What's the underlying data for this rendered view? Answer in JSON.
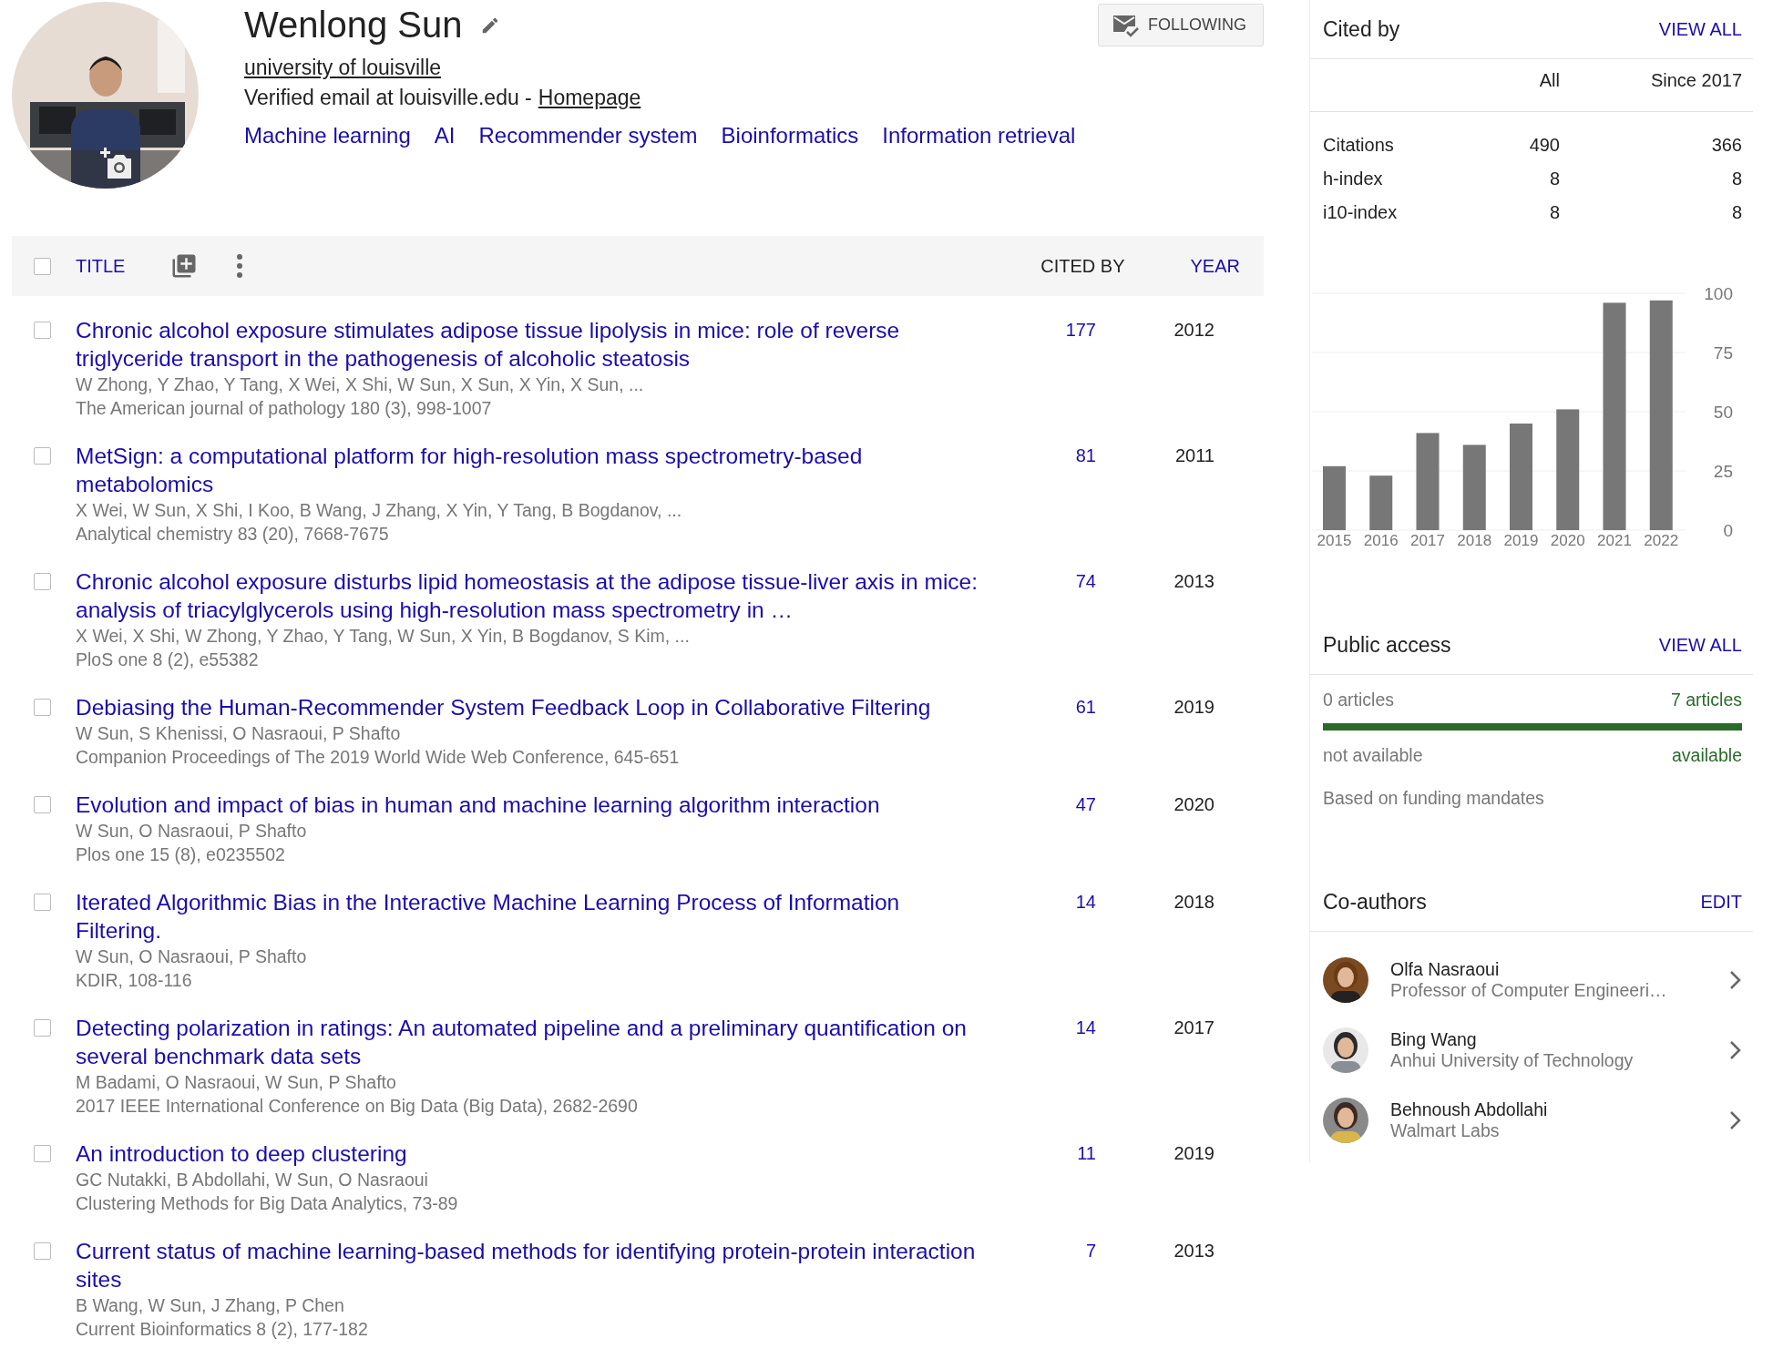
{
  "profile": {
    "name": "Wenlong Sun",
    "affiliation": "university of louisville",
    "email_text": "Verified email at louisville.edu -",
    "homepage": "Homepage",
    "interests": [
      "Machine learning",
      "AI",
      "Recommender system",
      "Bioinformatics",
      "Information retrieval"
    ],
    "follow_button": "FOLLOWING"
  },
  "table": {
    "select_all_checked": false,
    "columns": [
      {
        "label": "TITLE",
        "selected": false
      },
      {
        "label": "CITED BY",
        "selected": true
      },
      {
        "label": "YEAR",
        "selected": false
      }
    ],
    "rows": [
      {
        "title": "Chronic alcohol exposure stimulates adipose tissue lipolysis in mice: role of reverse triglyceride transport in the pathogenesis of alcoholic steatosis",
        "authors": "W Zhong, Y Zhao, Y Tang, X Wei, X Shi, W Sun, X Sun, X Yin, X Sun, ...",
        "venue": "The American journal of pathology 180 (3), 998-1007",
        "cited_by": "177",
        "year": "2012",
        "checked": false
      },
      {
        "title": "MetSign: a computational platform for high-resolution mass spectrometry-based metabolomics",
        "authors": "X Wei, W Sun, X Shi, I Koo, B Wang, J Zhang, X Yin, Y Tang, B Bogdanov, ...",
        "venue": "Analytical chemistry 83 (20), 7668-7675",
        "cited_by": "81",
        "year": "2011",
        "checked": false
      },
      {
        "title": "Chronic alcohol exposure disturbs lipid homeostasis at the adipose tissue-liver axis in mice: analysis of triacylglycerols using high-resolution mass spectrometry in …",
        "authors": "X Wei, X Shi, W Zhong, Y Zhao, Y Tang, W Sun, X Yin, B Bogdanov, S Kim, ...",
        "venue": "PloS one 8 (2), e55382",
        "cited_by": "74",
        "year": "2013",
        "checked": false
      },
      {
        "title": "Debiasing the Human-Recommender System Feedback Loop in Collaborative Filtering",
        "authors": "W Sun, S Khenissi, O Nasraoui, P Shafto",
        "venue": "Companion Proceedings of The 2019 World Wide Web Conference, 645-651",
        "cited_by": "61",
        "year": "2019",
        "checked": false
      },
      {
        "title": "Evolution and impact of bias in human and machine learning algorithm interaction",
        "authors": "W Sun, O Nasraoui, P Shafto",
        "venue": "Plos one 15 (8), e0235502",
        "cited_by": "47",
        "year": "2020",
        "checked": false
      },
      {
        "title": "Iterated Algorithmic Bias in the Interactive Machine Learning Process of Information Filtering.",
        "authors": "W Sun, O Nasraoui, P Shafto",
        "venue": "KDIR, 108-116",
        "cited_by": "14",
        "year": "2018",
        "checked": false
      },
      {
        "title": "Detecting polarization in ratings: An automated pipeline and a preliminary quantification on several benchmark data sets",
        "authors": "M Badami, O Nasraoui, W Sun, P Shafto",
        "venue": "2017 IEEE International Conference on Big Data (Big Data), 2682-2690",
        "cited_by": "14",
        "year": "2017",
        "checked": false
      },
      {
        "title": "An introduction to deep clustering",
        "authors": "GC Nutakki, B Abdollahi, W Sun, O Nasraoui",
        "venue": "Clustering Methods for Big Data Analytics, 73-89",
        "cited_by": "11",
        "year": "2019",
        "checked": false
      },
      {
        "title": "Current status of machine learning-based methods for identifying protein-protein interaction sites",
        "authors": "B Wang, W Sun, J Zhang, P Chen",
        "venue": "Current Bioinformatics 8 (2), 177-182",
        "cited_by": "7",
        "year": "2013",
        "checked": false
      }
    ]
  },
  "cited_by": {
    "heading": "Cited by",
    "link": "VIEW ALL",
    "columns": [
      "All",
      "Since 2017"
    ],
    "rows": [
      {
        "label": "Citations",
        "all": "490",
        "since": "366"
      },
      {
        "label": "h-index",
        "all": "8",
        "since": "8"
      },
      {
        "label": "i10-index",
        "all": "8",
        "since": "8"
      }
    ],
    "chart_data": {
      "type": "bar",
      "categories": [
        "2015",
        "2016",
        "2017",
        "2018",
        "2019",
        "2020",
        "2021",
        "2022"
      ],
      "values": [
        27,
        23,
        41,
        36,
        45,
        51,
        96,
        97
      ],
      "ylim": [
        0,
        100
      ],
      "grid": true,
      "yticks": [
        0,
        25,
        50,
        75,
        100
      ]
    }
  },
  "public_access": {
    "heading": "Public access",
    "link": "VIEW ALL",
    "unavailable_count": "0 articles",
    "available_count": "7 articles",
    "level": 1,
    "unavailable_label": "not available",
    "available_label": "available",
    "note": "Based on funding mandates"
  },
  "coauthors": {
    "heading": "Co-authors",
    "link": "EDIT",
    "people": [
      {
        "name": "Olfa Nasraoui",
        "affiliation": "Professor of Computer Engineeri…"
      },
      {
        "name": "Bing Wang",
        "affiliation": "Anhui University of Technology"
      },
      {
        "name": "Behnoush Abdollahi",
        "affiliation": "Walmart Labs"
      }
    ]
  }
}
